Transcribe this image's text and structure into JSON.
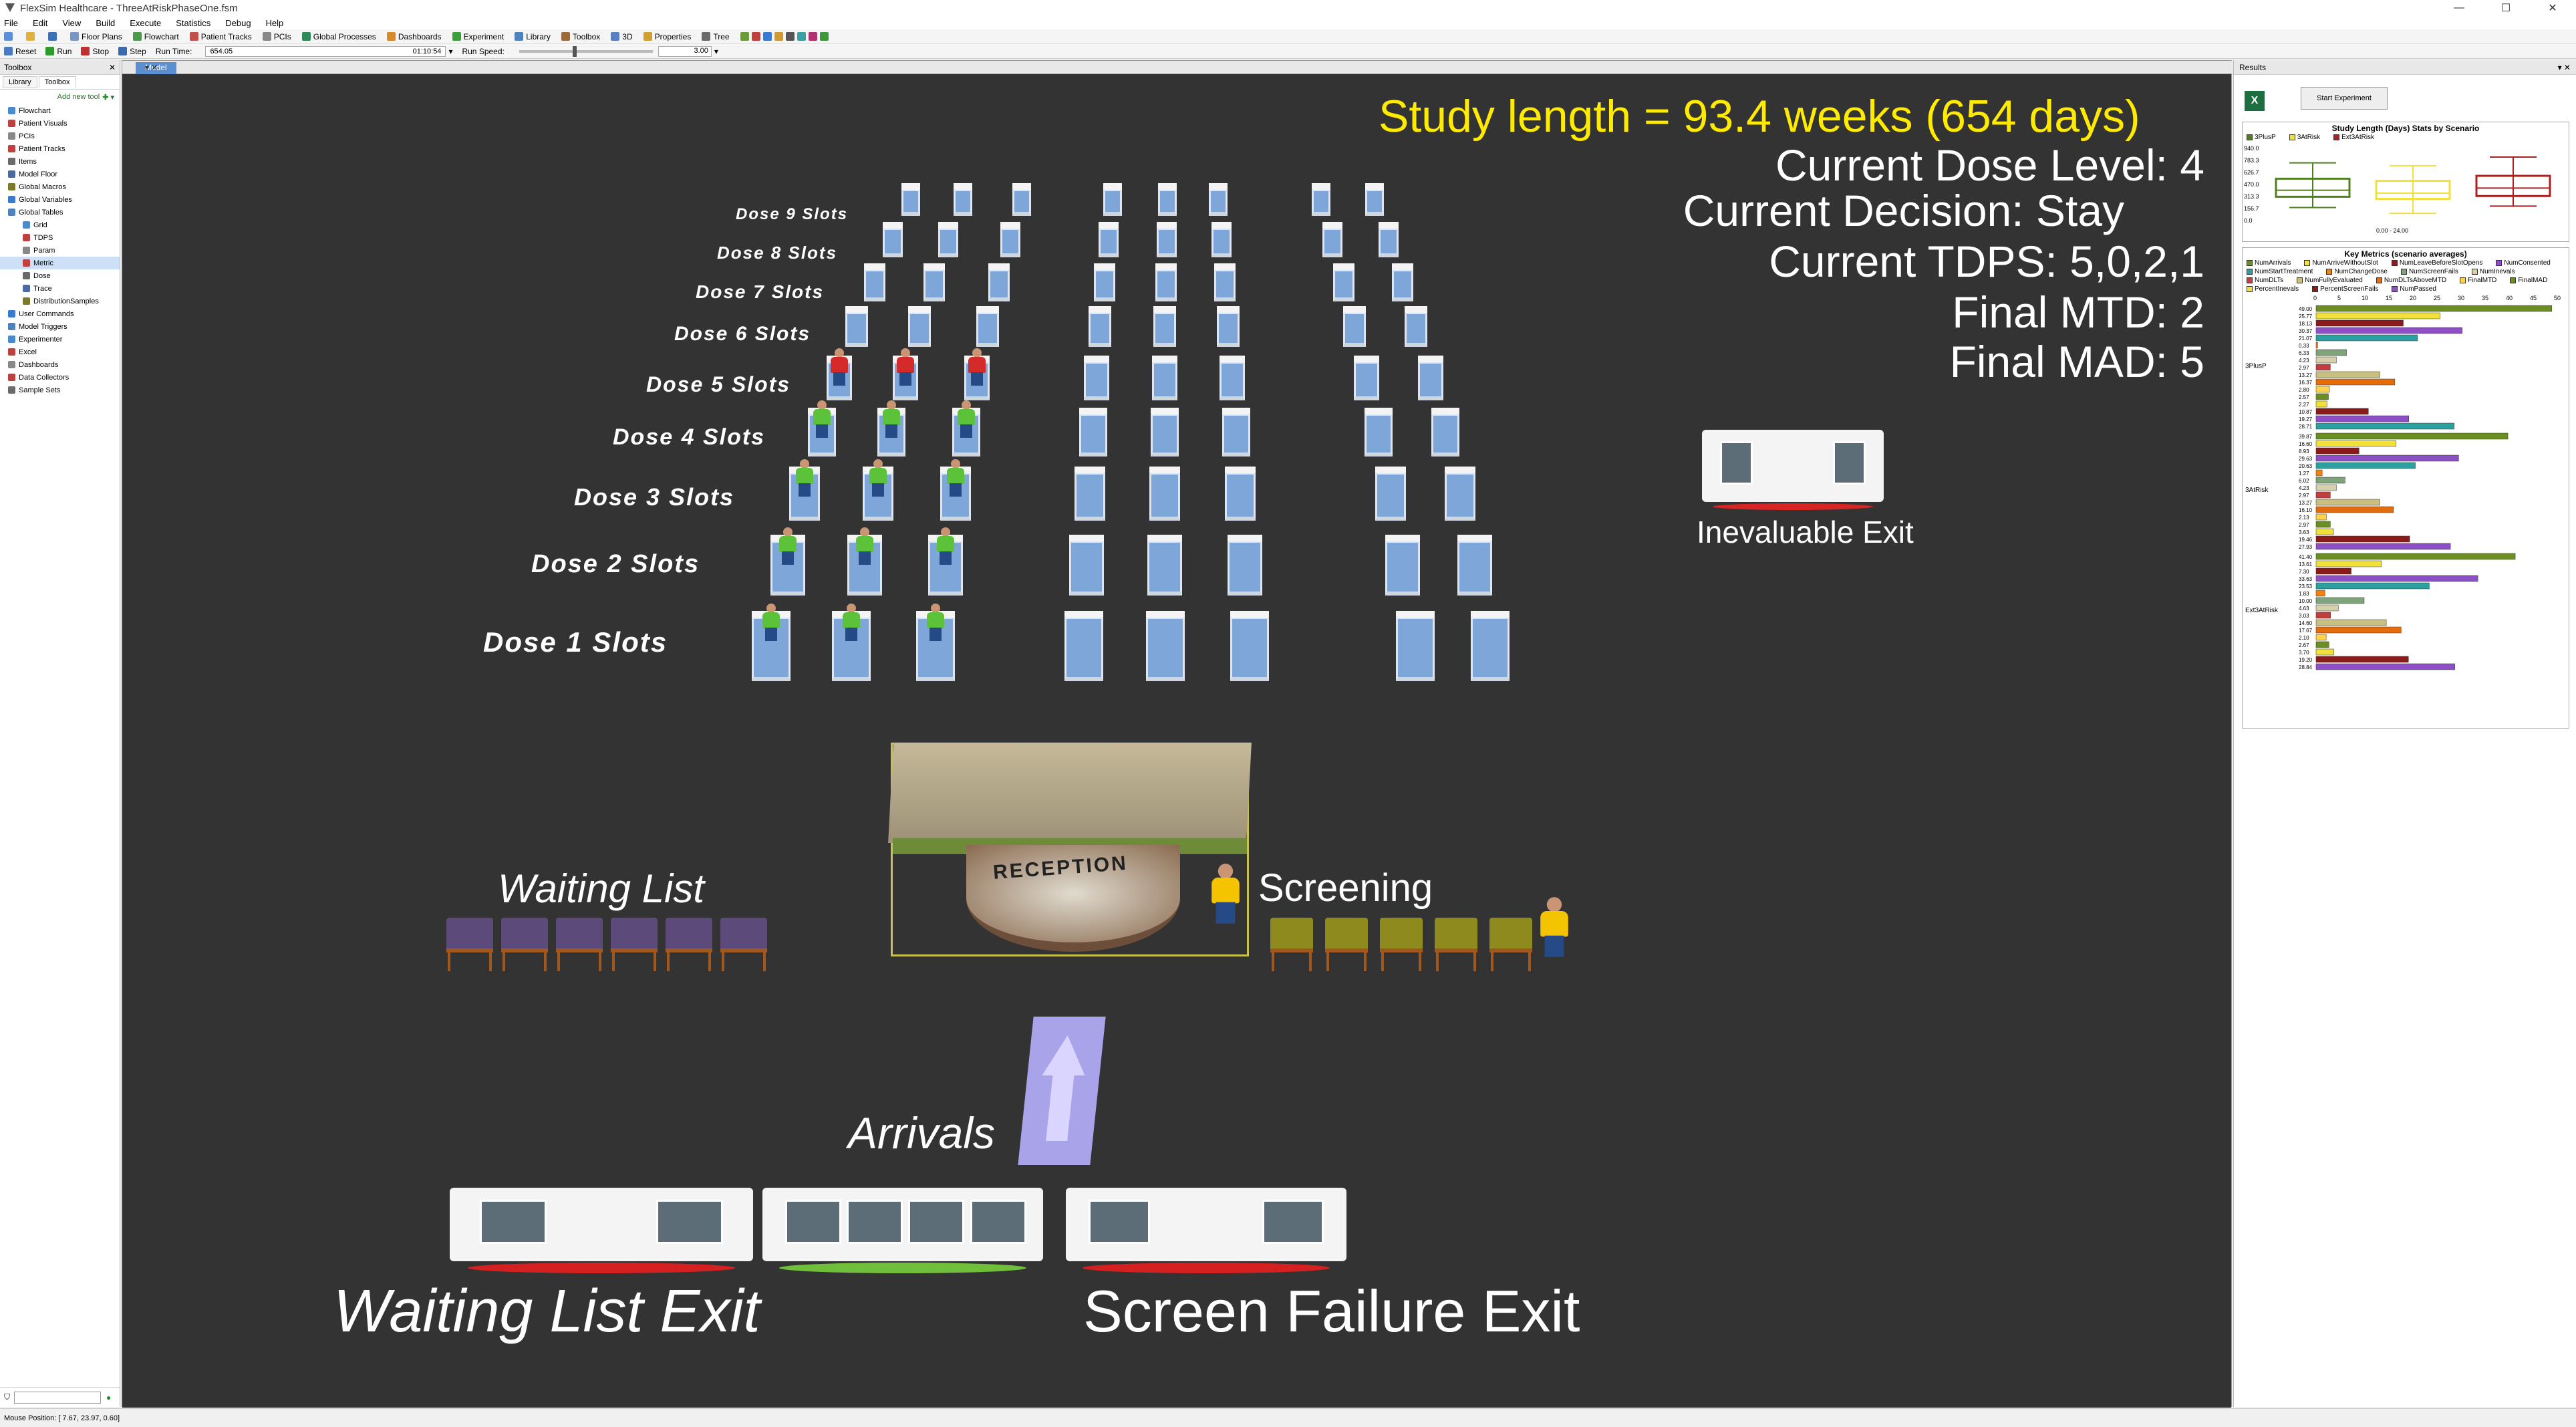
{
  "window": {
    "title": "FlexSim Healthcare - ThreeAtRiskPhaseOne.fsm"
  },
  "menu": [
    "File",
    "Edit",
    "View",
    "Build",
    "Execute",
    "Statistics",
    "Debug",
    "Help"
  ],
  "toolbar": [
    "Floor Plans",
    "Flowchart",
    "Patient Tracks",
    "PCIs",
    "Global Processes",
    "Dashboards",
    "Experiment",
    "Library",
    "Toolbox",
    "3D",
    "Properties",
    "Tree"
  ],
  "runbar": {
    "reset": "Reset",
    "run": "Run",
    "stop": "Stop",
    "step": "Step",
    "run_time_label": "Run Time:",
    "run_time_value": "654.05",
    "run_time_clock": "01:10:54",
    "run_speed_label": "Run Speed:",
    "run_speed_value": "3.00"
  },
  "toolbox": {
    "title": "Toolbox",
    "tabs": [
      "Library",
      "Toolbox"
    ],
    "add_tool": "Add new tool",
    "items": [
      "Flowchart",
      "Patient Visuals",
      "PCIs",
      "Patient Tracks",
      "Items",
      "Model Floor",
      "Global Macros",
      "Global Variables",
      "Global Tables",
      "Grid",
      "TDPS",
      "Param",
      "Metric",
      "Dose",
      "Trace",
      "DistributionSamples",
      "User Commands",
      "Model Triggers",
      "Experimenter",
      "Excel",
      "Dashboards",
      "Data Collectors",
      "Sample Sets"
    ],
    "selected": "Metric"
  },
  "model": {
    "tab": "Model",
    "study_length": "Study length = 93.4 weeks  (654 days)",
    "dose_level": "Current Dose Level: 4",
    "decision": "Current Decision: Stay",
    "tdps": "Current TDPS: 5,0,2,1",
    "final_mtd": "Final MTD: 2",
    "final_mad": "Final MAD: 5",
    "slot_labels": [
      "Dose 9 Slots",
      "Dose 8 Slots",
      "Dose 7 Slots",
      "Dose 6 Slots",
      "Dose 5 Slots",
      "Dose 4 Slots",
      "Dose 3 Slots",
      "Dose 2 Slots",
      "Dose 1 Slots"
    ],
    "inevaluable_exit": "Inevaluable Exit",
    "waiting_list": "Waiting List",
    "screening": "Screening",
    "arrivals": "Arrivals",
    "waiting_list_exit": "Waiting List Exit",
    "screen_failure_exit": "Screen Failure Exit",
    "reception_sign": "RECEPTION"
  },
  "results": {
    "title": "Results",
    "start_experiment": "Start Experiment",
    "excel_label": "X",
    "chart1_title": "Study Length (Days) Stats by Scenario",
    "chart1_legend": [
      "3PlusP",
      "3AtRisk",
      "Ext3AtRisk"
    ],
    "chart1_yticks": [
      "940.0",
      "783.3",
      "626.7",
      "470.0",
      "313.3",
      "156.7",
      "0.0"
    ],
    "chart1_xlabel": "0.00 - 24.00",
    "chart2_title": "Key Metrics (scenario averages)",
    "chart2_legend": [
      "NumArrivals",
      "NumArriveWithoutSlot",
      "NumLeaveBeforeSlotOpens",
      "NumConsented",
      "NumStartTreatment",
      "NumChangeDose",
      "NumScreenFails",
      "NumInevals",
      "NumDLTs",
      "NumFullyEvaluated",
      "NumDLTsAboveMTD",
      "FinalMTD",
      "FinalMAD",
      "PercentInevals",
      "PercentScreenFails",
      "NumPassed"
    ],
    "chart2_xticks": [
      "0",
      "5",
      "10",
      "15",
      "20",
      "25",
      "30",
      "35",
      "40",
      "45",
      "50"
    ]
  },
  "chart_data": {
    "type": "bar",
    "title": "Key Metrics (scenario averages)",
    "xlim": [
      0,
      50
    ],
    "series": [
      {
        "name": "3PlusP",
        "values": [
          49.0,
          25.77,
          18.13,
          30.37,
          21.07,
          0.33,
          6.33,
          4.23,
          2.97,
          13.27,
          16.37,
          2.8,
          2.57,
          2.27,
          10.87,
          19.27,
          28.71
        ]
      },
      {
        "name": "3AtRisk",
        "values": [
          39.87,
          16.6,
          8.93,
          29.63,
          20.63,
          1.27,
          6.02,
          4.23,
          2.97,
          13.27,
          16.1,
          2.13,
          2.97,
          3.63,
          19.46,
          27.93
        ]
      },
      {
        "name": "Ext3AtRisk",
        "values": [
          41.4,
          13.61,
          7.3,
          33.63,
          23.53,
          1.83,
          10.0,
          4.63,
          3.03,
          14.6,
          17.67,
          2.1,
          2.67,
          3.7,
          19.2,
          28.84
        ]
      }
    ],
    "colors": [
      "#6b8e23",
      "#f2e13a",
      "#8b1a1a",
      "#8e4fc6",
      "#2aa0a0",
      "#f0820f",
      "#7fa37a",
      "#d6d0ad",
      "#c04040",
      "#c9c080",
      "#e46c0a",
      "#ffd34d"
    ]
  },
  "status": {
    "mouse": "Mouse Position: [ 7.67, 23.97, 0.60]"
  }
}
